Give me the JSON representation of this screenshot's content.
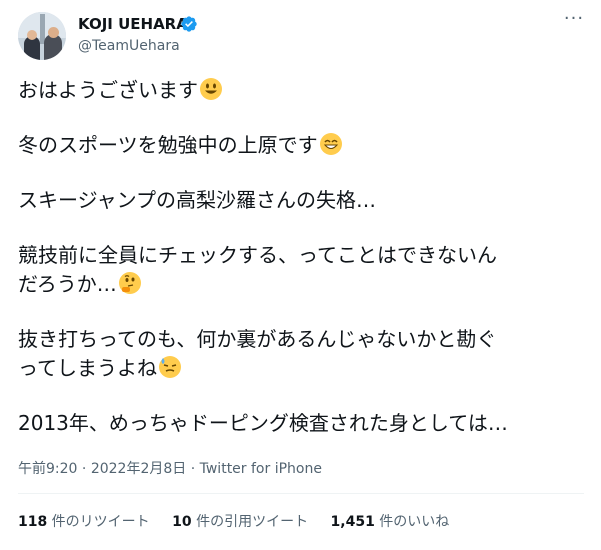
{
  "user": {
    "display_name": "KOJI UEHARA",
    "handle": "@TeamUehara",
    "verified_icon": "verified-badge-icon",
    "avatar_icon": "profile-photo"
  },
  "menu_icon": "more-options-icon",
  "tweet": {
    "line1": "おはようございます",
    "line2": "冬のスポーツを勉強中の上原です",
    "line3": "スキージャンプの高梨沙羅さんの失格…",
    "line4": "競技前に全員にチェックする、ってことはできないん\nだろうか…",
    "line5": "抜き打ちってのも、何か裏があるんじゃないかと勘ぐ\nってしまうよね",
    "line6": "2013年、めっちゃドーピング検査された身としては…"
  },
  "meta": {
    "time": "午前9:20",
    "sep1": " · ",
    "date": "2022年2月8日",
    "sep2": " · ",
    "source": "Twitter for iPhone"
  },
  "stats": {
    "retweets_num": "118",
    "retweets_label": " 件のリツイート",
    "quotes_num": "10",
    "quotes_label": " 件の引用ツイート",
    "likes_num": "1,451",
    "likes_label": " 件のいいね"
  },
  "colors": {
    "text": "#0f1419",
    "secondary": "#536471",
    "verified": "#1d9bf0",
    "emoji": "#ffcc4d"
  }
}
